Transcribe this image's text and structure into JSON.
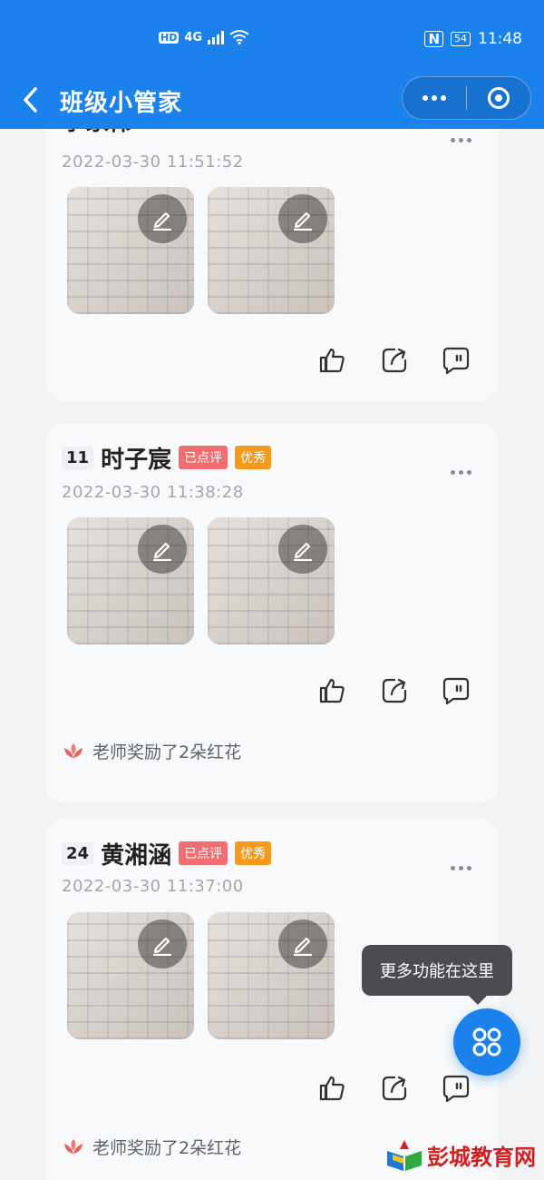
{
  "status_bar": {
    "network_hd": "HD",
    "network_gen": "4G",
    "nfc": "N",
    "battery": "54",
    "time": "11:48"
  },
  "title_bar": {
    "title": "班级小管家",
    "colors": {
      "primary": "#1b82ec"
    }
  },
  "posts": [
    {
      "number": "",
      "name": "李家伟",
      "tags": [],
      "timestamp": "2022-03-30 11:51:52",
      "photos": [
        "homework-photo",
        "homework-photo"
      ],
      "reward": ""
    },
    {
      "number": "11",
      "name": "时子宸",
      "tags": [
        "已点评",
        "优秀"
      ],
      "timestamp": "2022-03-30 11:38:28",
      "photos": [
        "homework-photo",
        "homework-photo"
      ],
      "reward": "老师奖励了2朵红花"
    },
    {
      "number": "24",
      "name": "黄湘涵",
      "tags": [
        "已点评",
        "优秀"
      ],
      "timestamp": "2022-03-30 11:37:00",
      "photos": [
        "homework-photo",
        "homework-photo"
      ],
      "reward": "老师奖励了2朵红花"
    }
  ],
  "tooltip": {
    "text": "更多功能在这里"
  },
  "watermark": {
    "text": "彭城教育网"
  },
  "icons": {
    "back": "chevron-left-icon",
    "more": "more-dots-icon",
    "edit": "pencil-icon",
    "like": "thumb-up-icon",
    "share": "share-icon",
    "comment": "comment-icon",
    "flower": "red-flower-icon",
    "fab": "grid-menu-icon"
  }
}
